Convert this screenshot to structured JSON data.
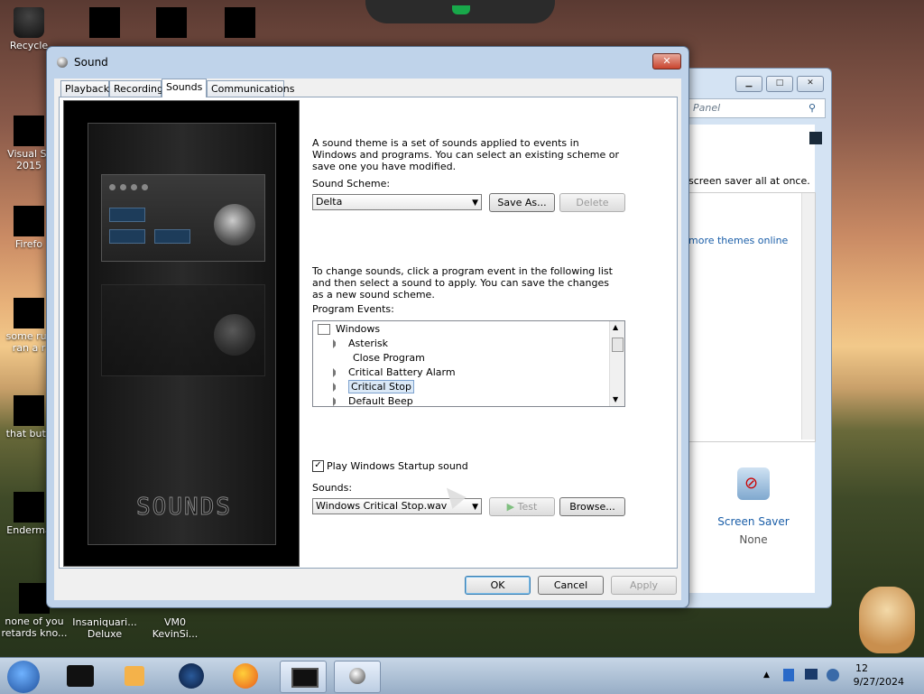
{
  "desktop": {
    "icons": [
      {
        "label": "Recycle",
        "label2": ""
      },
      {
        "label": "Visual St",
        "label2": "2015"
      },
      {
        "label": "Firefo",
        "label2": ""
      },
      {
        "label": "some rus",
        "label2": "ran a r"
      },
      {
        "label": "that but i",
        "label2": ""
      },
      {
        "label": "Enderma",
        "label2": ""
      },
      {
        "label": "none of you",
        "label2": "retards kno..."
      },
      {
        "label": "Insaniquari...",
        "label2": "Deluxe"
      },
      {
        "label": "VM0",
        "label2": "KevinSi..."
      }
    ]
  },
  "back_window": {
    "address_placeholder": "Panel",
    "text1": "screen saver all at once.",
    "link": "more themes online",
    "screen_saver_label": "Screen Saver",
    "screen_saver_value": "None"
  },
  "dialog": {
    "title": "Sound",
    "close_label": "✕",
    "tabs": [
      "Playback",
      "Recording",
      "Sounds",
      "Communications"
    ],
    "active_tab": "Sounds",
    "art_logo": "SOUNDS",
    "intro": "A sound theme is a set of sounds applied to events in Windows and programs.  You can select an existing scheme or save one you have modified.",
    "sound_scheme_label": "Sound Scheme:",
    "sound_scheme_value": "Delta",
    "save_as_label": "Save As...",
    "delete_label": "Delete",
    "change_text": "To change sounds, click a program event in the following list and then select a sound to apply.  You can save the changes as a new sound scheme.",
    "program_events_label": "Program Events:",
    "events": [
      {
        "label": "Windows",
        "level": 0,
        "has_sound": false
      },
      {
        "label": "Asterisk",
        "level": 1,
        "has_sound": true
      },
      {
        "label": "Close Program",
        "level": 1,
        "has_sound": false
      },
      {
        "label": "Critical Battery Alarm",
        "level": 1,
        "has_sound": true
      },
      {
        "label": "Critical Stop",
        "level": 1,
        "has_sound": true,
        "selected": true
      },
      {
        "label": "Default Beep",
        "level": 1,
        "has_sound": true
      }
    ],
    "startup_checkbox_label": "Play Windows Startup sound",
    "startup_checked": true,
    "sounds_label": "Sounds:",
    "sounds_value": "Windows Critical Stop.wav",
    "test_label": "Test",
    "browse_label": "Browse...",
    "ok_label": "OK",
    "cancel_label": "Cancel",
    "apply_label": "Apply"
  },
  "taskbar": {
    "time": "12",
    "date": "9/27/2024"
  },
  "colors": {
    "dialog_frame": "#bfd3ea",
    "selection": "#dbe9f7",
    "taskbar": "#a9bdd4"
  }
}
